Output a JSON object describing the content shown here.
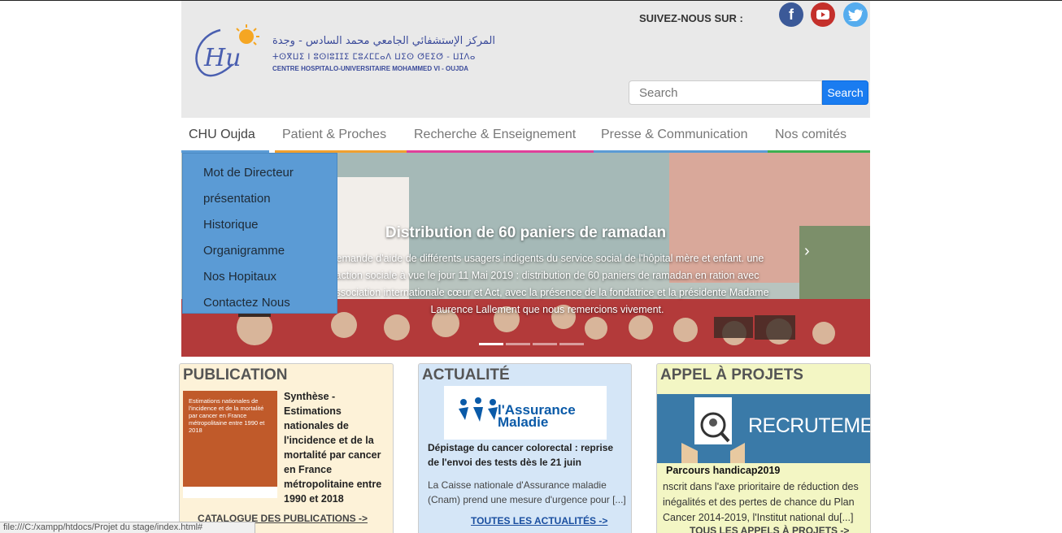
{
  "header": {
    "logo_arabic": "المركز الإستشفائي الجامعي محمد السادس - وجدة",
    "logo_tifinagh": "ⵜⵙⴳⵡⵉ ⵏ ⵓⵙⵏⵓⵊⵊⵉ ⵎⵓⵃⵎⵎⴰⴷ ⵡⵉⵙ ⵚⴹⵉⵚ - ⵡⵊⴷⴰ",
    "logo_french": "CENTRE HOSPITALO-UNIVERSITAIRE MOHAMMED VI - OUJDA",
    "follow_label": "SUIVEZ-NOUS SUR :",
    "social": [
      {
        "icon": "facebook-icon",
        "glyph": "f",
        "color": "#3b5998"
      },
      {
        "icon": "youtube-icon",
        "glyph": "▶",
        "color": "#c4302b"
      },
      {
        "icon": "twitter-icon",
        "glyph": "🐦",
        "color": "#55acee"
      }
    ],
    "search_placeholder": "Search",
    "search_button": "Search"
  },
  "nav": {
    "items": [
      {
        "label": "CHU Oujda",
        "color": "#5b9bd5"
      },
      {
        "label": "Patient & Proches",
        "color": "#f0a030"
      },
      {
        "label": "Recherche & Enseignement",
        "color": "#e0409a"
      },
      {
        "label": "Presse & Communication",
        "color": "#5b9bd5"
      },
      {
        "label": "Nos comités",
        "color": "#3cb050"
      }
    ],
    "dropdown": [
      "Mot de Directeur",
      "présentation",
      "Historique",
      "Organigramme",
      "Nos Hopitaux",
      "Contactez Nous"
    ]
  },
  "hero": {
    "title": "Distribution de 60 paniers de ramadan",
    "text": "demande d'aide de différents usagers indigents du service social de l'hôpital mère et enfant. une action sociale à vue le jour 11 Mai 2019 : distribution de 60 paniers de ramadan en ration avec l'association internationale cœur et Act, avec la présence de la fondatrice et la présidente Madame Laurence Lallement que nous remercions vivement."
  },
  "publication": {
    "title": "PUBLICATION",
    "cover_text": "Estimations nationales de l'incidence et de la mortalité par cancer en France métropolitaine entre 1990 et 2018",
    "text": "Synthèse - Estimations nationales de l'incidence et de la mortalité par cancer en France métropolitaine entre 1990 et 2018",
    "link": "CATALOGUE DES PUBLICATIONS ->"
  },
  "actualite": {
    "title": "ACTUALITÉ",
    "logo_text_1": "l'Assurance",
    "logo_text_2": "Maladie",
    "headline": "Dépistage du cancer colorectal : reprise de l'envoi des tests dès le 21 juin",
    "text": "La Caisse nationale d'Assurance maladie (Cnam) prend une mesure d'urgence pour [...]",
    "link": "TOUTES LES ACTUALITÉS ->"
  },
  "appel": {
    "title": "APPEL À PROJETS",
    "banner_text": "RECRUTEMENT",
    "headline": "Parcours handicap2019",
    "text": "nscrit dans l'axe prioritaire de réduction des inégalités et des pertes de chance du Plan Cancer 2014-2019, l'Institut national du[...]",
    "link": "TOUS LES APPELS À PROJETS ->"
  },
  "statusbar": "file:///C:/xampp/htdocs/Projet du stage/index.html#"
}
